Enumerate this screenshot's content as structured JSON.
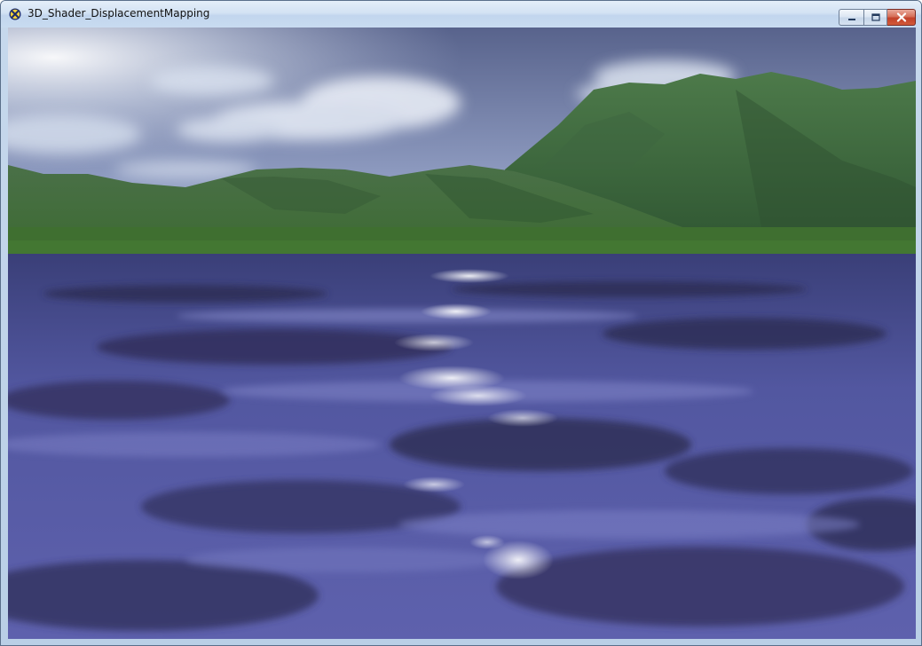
{
  "window": {
    "title": "3D_Shader_DisplacementMapping",
    "icon": "directx-x-icon"
  },
  "caption_buttons": {
    "minimize": "minimize-icon",
    "maximize": "maximize-icon",
    "close": "close-icon"
  },
  "scene": {
    "description_none": "",
    "colors": {
      "sky_top": "#5b6690",
      "sky_haze": "#dfe7f3",
      "mountain": "#3f6b3e",
      "water": "#5a5fa6",
      "water_dark": "#2e2c52",
      "highlight": "#ffffff"
    }
  }
}
